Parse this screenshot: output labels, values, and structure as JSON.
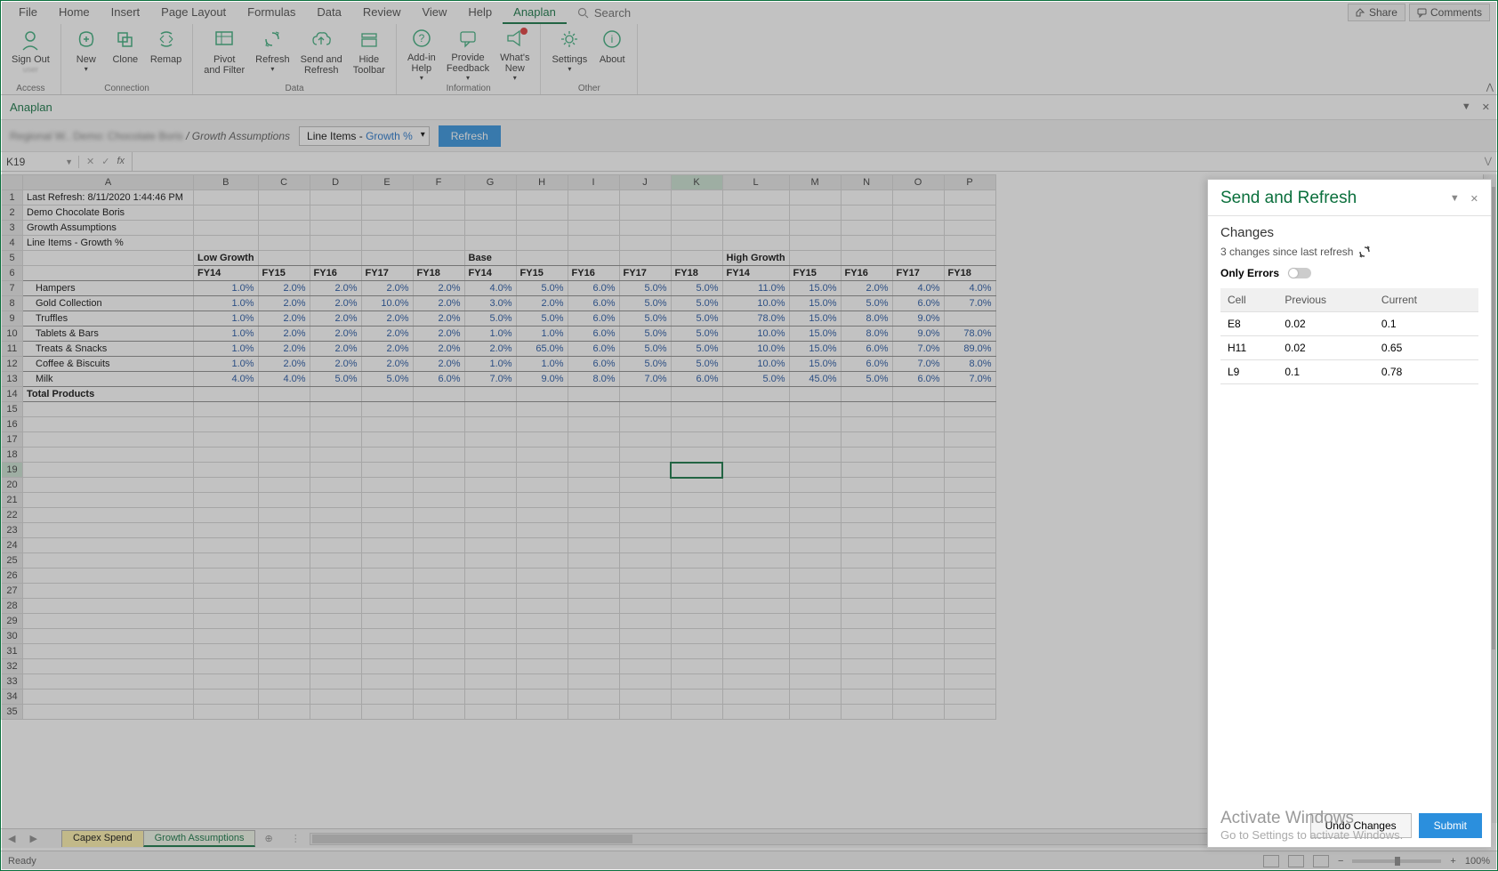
{
  "tabs": [
    "File",
    "Home",
    "Insert",
    "Page Layout",
    "Formulas",
    "Data",
    "Review",
    "View",
    "Help",
    "Anaplan"
  ],
  "active_tab_index": 9,
  "search_placeholder": "Search",
  "share": "Share",
  "comments": "Comments",
  "ribbon_groups": {
    "access": {
      "label": "Access",
      "buttons": [
        {
          "label": "Sign Out"
        },
        {
          "label": ""
        }
      ]
    },
    "connection": {
      "label": "Connection",
      "buttons": [
        {
          "label": "New"
        },
        {
          "label": "Clone"
        },
        {
          "label": "Remap"
        }
      ]
    },
    "data": {
      "label": "Data",
      "buttons": [
        {
          "label": "Pivot\nand Filter"
        },
        {
          "label": "Refresh"
        },
        {
          "label": "Send and\nRefresh"
        },
        {
          "label": "Hide\nToolbar"
        }
      ]
    },
    "information": {
      "label": "Information",
      "buttons": [
        {
          "label": "Add-in\nHelp"
        },
        {
          "label": "Provide\nFeedback"
        },
        {
          "label": "What's\nNew"
        }
      ]
    },
    "other": {
      "label": "Other",
      "buttons": [
        {
          "label": "Settings"
        },
        {
          "label": "About"
        }
      ]
    }
  },
  "anaplan_bar": "Anaplan",
  "breadcrumb_suffix": " / Growth Assumptions",
  "line_items_prefix": "Line Items - ",
  "line_items_link": "Growth %",
  "refresh_btn": "Refresh",
  "name_box": "K19",
  "col_headers": [
    "A",
    "B",
    "C",
    "D",
    "E",
    "F",
    "G",
    "H",
    "I",
    "J",
    "K",
    "L",
    "M",
    "N",
    "O",
    "P"
  ],
  "active_col": "K",
  "active_row": 19,
  "info_rows": [
    "Last Refresh: 8/11/2020 1:44:46 PM",
    "Demo Chocolate Boris",
    "Growth Assumptions",
    "Line Items - Growth %"
  ],
  "group_headers": {
    "B": "Low Growth",
    "G": "Base",
    "L": "High Growth"
  },
  "fy_row": [
    "FY14",
    "FY15",
    "FY16",
    "FY17",
    "FY18",
    "FY14",
    "FY15",
    "FY16",
    "FY17",
    "FY18",
    "FY14",
    "FY15",
    "FY16",
    "FY17",
    "FY18"
  ],
  "products": [
    {
      "name": "Hampers",
      "v": [
        "1.0%",
        "2.0%",
        "2.0%",
        "2.0%",
        "2.0%",
        "4.0%",
        "5.0%",
        "6.0%",
        "5.0%",
        "5.0%",
        "11.0%",
        "15.0%",
        "2.0%",
        "4.0%",
        "4.0%"
      ]
    },
    {
      "name": "Gold Collection",
      "v": [
        "1.0%",
        "2.0%",
        "2.0%",
        "10.0%",
        "2.0%",
        "3.0%",
        "2.0%",
        "6.0%",
        "5.0%",
        "5.0%",
        "10.0%",
        "15.0%",
        "5.0%",
        "6.0%",
        "7.0%"
      ]
    },
    {
      "name": "Truffles",
      "v": [
        "1.0%",
        "2.0%",
        "2.0%",
        "2.0%",
        "2.0%",
        "5.0%",
        "5.0%",
        "6.0%",
        "5.0%",
        "5.0%",
        "78.0%",
        "15.0%",
        "8.0%",
        "9.0%",
        ""
      ]
    },
    {
      "name": "Tablets & Bars",
      "v": [
        "1.0%",
        "2.0%",
        "2.0%",
        "2.0%",
        "2.0%",
        "1.0%",
        "1.0%",
        "6.0%",
        "5.0%",
        "5.0%",
        "10.0%",
        "15.0%",
        "8.0%",
        "9.0%",
        "78.0%"
      ]
    },
    {
      "name": "Treats & Snacks",
      "v": [
        "1.0%",
        "2.0%",
        "2.0%",
        "2.0%",
        "2.0%",
        "2.0%",
        "65.0%",
        "6.0%",
        "5.0%",
        "5.0%",
        "10.0%",
        "15.0%",
        "6.0%",
        "7.0%",
        "89.0%"
      ]
    },
    {
      "name": "Coffee & Biscuits",
      "v": [
        "1.0%",
        "2.0%",
        "2.0%",
        "2.0%",
        "2.0%",
        "1.0%",
        "1.0%",
        "6.0%",
        "5.0%",
        "5.0%",
        "10.0%",
        "15.0%",
        "6.0%",
        "7.0%",
        "8.0%"
      ]
    },
    {
      "name": "Milk",
      "v": [
        "4.0%",
        "4.0%",
        "5.0%",
        "5.0%",
        "6.0%",
        "7.0%",
        "9.0%",
        "8.0%",
        "7.0%",
        "6.0%",
        "5.0%",
        "45.0%",
        "5.0%",
        "6.0%",
        "7.0%"
      ]
    }
  ],
  "total_label": "Total Products",
  "side_panel": {
    "title": "Send and Refresh",
    "changes_h": "Changes",
    "since": "3 changes since last refresh",
    "only_errors": "Only Errors",
    "cols": {
      "cell": "Cell",
      "prev": "Previous",
      "curr": "Current"
    },
    "rows": [
      {
        "cell": "E8",
        "prev": "0.02",
        "curr": "0.1"
      },
      {
        "cell": "H11",
        "prev": "0.02",
        "curr": "0.65"
      },
      {
        "cell": "L9",
        "prev": "0.1",
        "curr": "0.78"
      }
    ],
    "undo": "Undo Changes",
    "submit": "Submit"
  },
  "watermark": {
    "l1": "Activate Windows",
    "l2": "Go to Settings to activate Windows."
  },
  "sheet_tabs": [
    {
      "name": "Capex Spend",
      "kind": "yellow"
    },
    {
      "name": "Growth Assumptions",
      "kind": "active"
    }
  ],
  "status_ready": "Ready",
  "zoom": "100%"
}
